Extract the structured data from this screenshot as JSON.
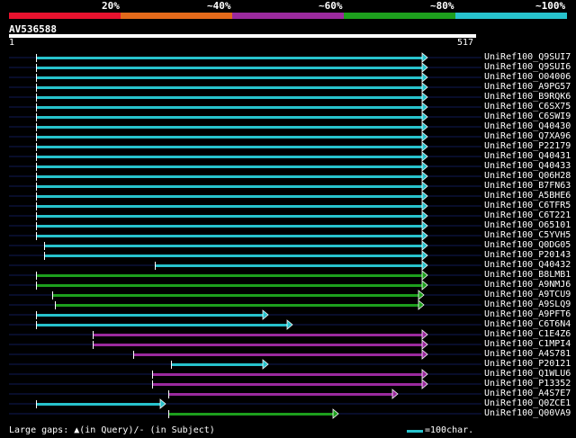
{
  "legend": {
    "bands": [
      {
        "label": "20%",
        "color": "#e8122e"
      },
      {
        "label": "~40%",
        "color": "#e46a1a"
      },
      {
        "label": "~60%",
        "color": "#9b2a9e"
      },
      {
        "label": "~80%",
        "color": "#1d9f1d"
      },
      {
        "label": "~100%",
        "color": "#27c2cc"
      }
    ]
  },
  "query": {
    "id": "AV536588",
    "start": "1",
    "end": "517"
  },
  "colors": {
    "cyan": "#27c2cc",
    "green": "#1d9f1d",
    "magenta": "#9b2a9e",
    "row_line": "#0f1a55",
    "marker": "#ffff99"
  },
  "hits": [
    {
      "name": "UniRef100_Q9SUI7",
      "color": "cyan",
      "s": 40,
      "e": 474
    },
    {
      "name": "UniRef100_Q9SUI6",
      "color": "cyan",
      "s": 40,
      "e": 474
    },
    {
      "name": "UniRef100_O04006",
      "color": "cyan",
      "s": 40,
      "e": 474
    },
    {
      "name": "UniRef100_A9PG57",
      "color": "cyan",
      "s": 40,
      "e": 474
    },
    {
      "name": "UniRef100_B9RQK6",
      "color": "cyan",
      "s": 40,
      "e": 474
    },
    {
      "name": "UniRef100_C6SX75",
      "color": "cyan",
      "s": 40,
      "e": 474
    },
    {
      "name": "UniRef100_C6SWI9",
      "color": "cyan",
      "s": 40,
      "e": 474
    },
    {
      "name": "UniRef100_Q40430",
      "color": "cyan",
      "s": 40,
      "e": 474
    },
    {
      "name": "UniRef100_Q7XA96",
      "color": "cyan",
      "s": 40,
      "e": 474
    },
    {
      "name": "UniRef100_P22179",
      "color": "cyan",
      "s": 40,
      "e": 474
    },
    {
      "name": "UniRef100_Q40431",
      "color": "cyan",
      "s": 40,
      "e": 474
    },
    {
      "name": "UniRef100_Q40433",
      "color": "cyan",
      "s": 40,
      "e": 474
    },
    {
      "name": "UniRef100_Q06H28",
      "color": "cyan",
      "s": 40,
      "e": 474
    },
    {
      "name": "UniRef100_B7FN63",
      "color": "cyan",
      "s": 40,
      "e": 474
    },
    {
      "name": "UniRef100_A5BHE6",
      "color": "cyan",
      "s": 40,
      "e": 474
    },
    {
      "name": "UniRef100_C6TFR5",
      "color": "cyan",
      "s": 40,
      "e": 474
    },
    {
      "name": "UniRef100_C6T221",
      "color": "cyan",
      "s": 40,
      "e": 474
    },
    {
      "name": "UniRef100_O65101",
      "color": "cyan",
      "s": 40,
      "e": 474
    },
    {
      "name": "UniRef100_C5YVH5",
      "color": "cyan",
      "s": 40,
      "e": 474
    },
    {
      "name": "UniRef100_Q0DG05",
      "color": "cyan",
      "s": 49,
      "e": 474
    },
    {
      "name": "UniRef100_P20143",
      "color": "cyan",
      "s": 49,
      "e": 474
    },
    {
      "name": "UniRef100_Q40432",
      "color": "cyan",
      "s": 172,
      "e": 474
    },
    {
      "name": "UniRef100_B8LMB1",
      "color": "green",
      "s": 40,
      "e": 474
    },
    {
      "name": "UniRef100_A9NMJ6",
      "color": "green",
      "s": 40,
      "e": 474
    },
    {
      "name": "UniRef100_A9TCU9",
      "color": "green",
      "s": 58,
      "e": 470
    },
    {
      "name": "UniRef100_A9SLQ9",
      "color": "green",
      "s": 61,
      "e": 470
    },
    {
      "name": "UniRef100_A9PFT6",
      "color": "cyan",
      "s": 40,
      "e": 297
    },
    {
      "name": "UniRef100_C6T6N4",
      "color": "cyan",
      "s": 40,
      "e": 324
    },
    {
      "name": "UniRef100_C1E4Z6",
      "color": "magenta",
      "s": 103,
      "e": 474
    },
    {
      "name": "UniRef100_C1MPI4",
      "color": "magenta",
      "s": 103,
      "e": 474
    },
    {
      "name": "UniRef100_A4S781",
      "color": "magenta",
      "s": 148,
      "e": 474
    },
    {
      "name": "UniRef100_P20121",
      "color": "cyan",
      "s": 190,
      "e": 297
    },
    {
      "name": "UniRef100_Q1WLU6",
      "color": "magenta",
      "s": 169,
      "e": 474
    },
    {
      "name": "UniRef100_P13352",
      "color": "magenta",
      "s": 169,
      "e": 474
    },
    {
      "name": "UniRef100_A4S7E7",
      "color": "magenta",
      "s": 187,
      "e": 441
    },
    {
      "name": "UniRef100_Q0ZCE1",
      "color": "cyan",
      "s": 40,
      "e": 183
    },
    {
      "name": "UniRef100_Q00VA9",
      "color": "green",
      "s": 187,
      "e": 375
    }
  ],
  "footer": {
    "left": "Large gaps: ▲(in Query)/- (in Subject)",
    "right": "=100char."
  }
}
